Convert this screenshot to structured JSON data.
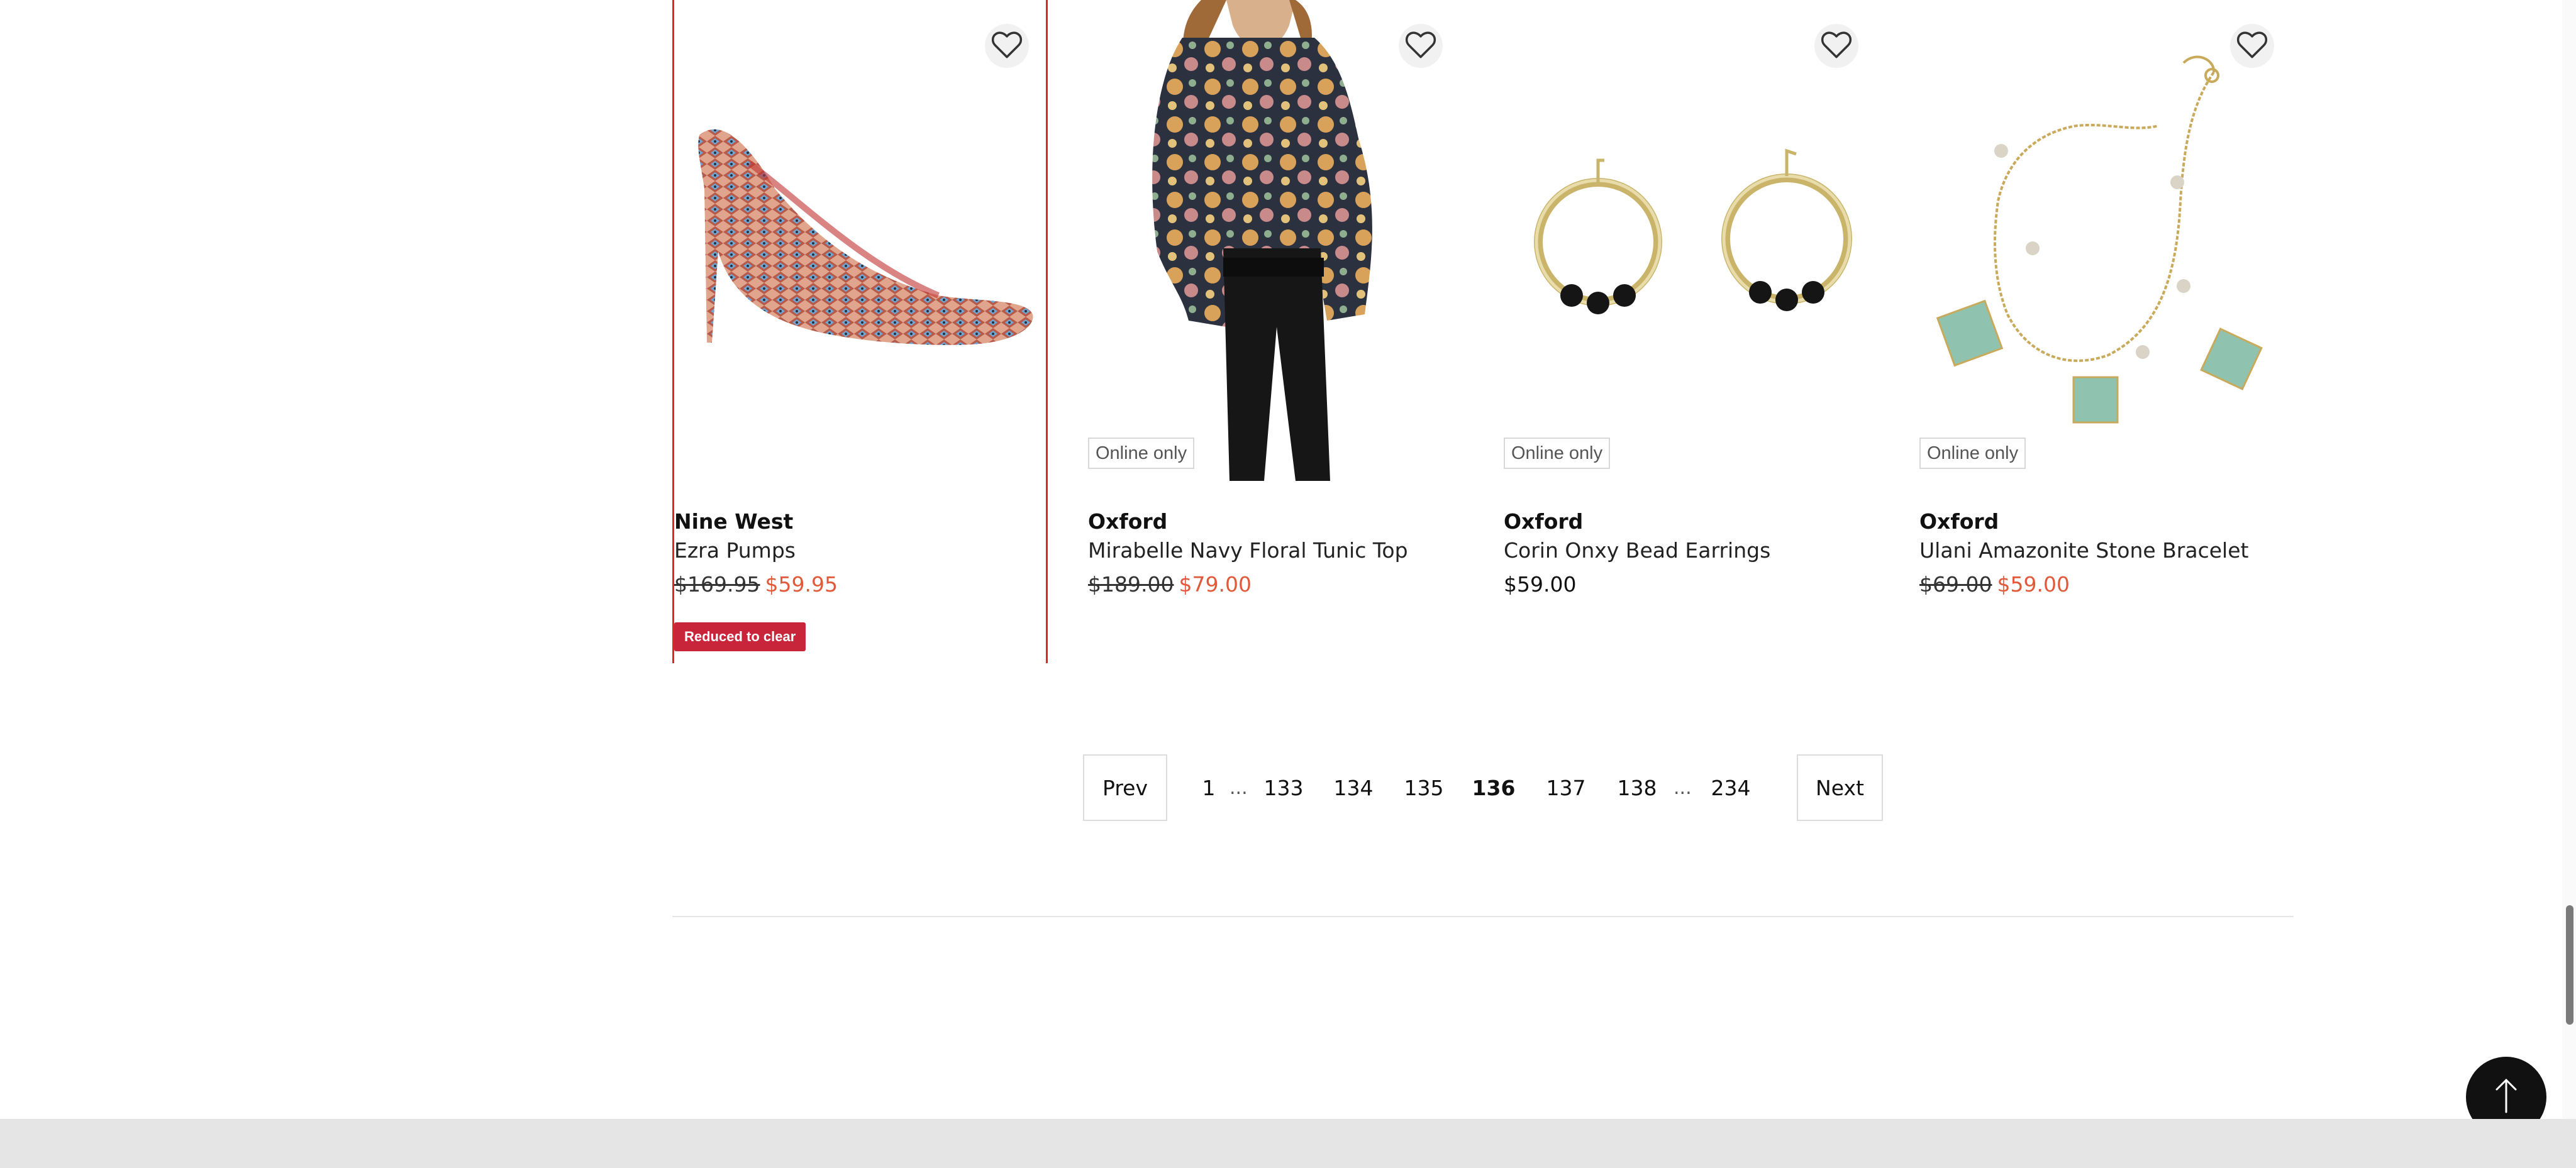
{
  "products": [
    {
      "brand": "Nine West",
      "name": "Ezra Pumps",
      "was_price": "$169.95",
      "price": "$59.95",
      "online_badge": "",
      "tag": "Reduced to clear",
      "image": "snakeskin-pump-shoe"
    },
    {
      "brand": "Oxford",
      "name": "Mirabelle Navy Floral Tunic Top",
      "was_price": "$189.00",
      "price": "$79.00",
      "online_badge": "Online only",
      "tag": "",
      "image": "floral-blouse-model"
    },
    {
      "brand": "Oxford",
      "name": "Corin Onxy Bead Earrings",
      "was_price": "",
      "price": "$59.00",
      "online_badge": "Online only",
      "tag": "",
      "image": "gold-hoop-earrings"
    },
    {
      "brand": "Oxford",
      "name": "Ulani Amazonite Stone Bracelet",
      "was_price": "$69.00",
      "price": "$59.00",
      "online_badge": "Online only",
      "tag": "",
      "image": "charm-bracelet"
    }
  ],
  "pagination": {
    "prev": "Prev",
    "next": "Next",
    "ellipsis": "...",
    "pages": [
      "1",
      "133",
      "134",
      "135",
      "136",
      "137",
      "138",
      "234"
    ],
    "current": "136"
  },
  "icons": {
    "wishlist": "heart-outline-icon",
    "back_to_top": "arrow-up-icon"
  },
  "colors": {
    "sale_price": "#e05a3a",
    "reduced_tag": "#c8253a",
    "selected_card_border": "#d9272e"
  }
}
